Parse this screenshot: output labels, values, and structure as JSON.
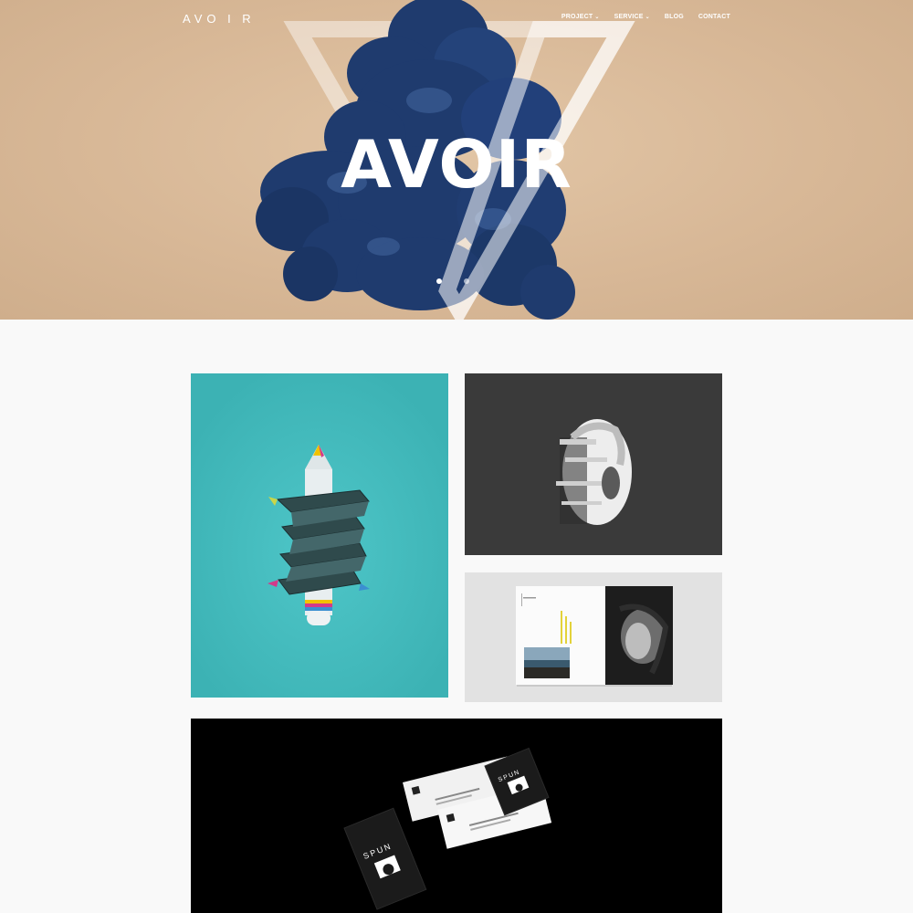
{
  "header": {
    "logo": "AVO I R",
    "nav": [
      {
        "label": "PROJECT",
        "has_dropdown": true
      },
      {
        "label": "SERVICE",
        "has_dropdown": true
      },
      {
        "label": "BLOG",
        "has_dropdown": false
      },
      {
        "label": "CONTACT",
        "has_dropdown": false
      }
    ]
  },
  "hero": {
    "title": "AVOIR",
    "slider_count": 2,
    "active_slide": 1
  },
  "portfolio": {
    "items": [
      {
        "name": "pencil-artwork"
      },
      {
        "name": "portrait-artwork"
      },
      {
        "name": "magazine-mockup"
      },
      {
        "name": "business-card-mockup",
        "brand_text": "SPUN"
      }
    ]
  },
  "colors": {
    "hero_bg": "#d8b897",
    "teal": "#41b7b9",
    "dark_tile": "#3a3a3a",
    "light_tile": "#e2e2e2",
    "ink_blue": "#1e3a6e"
  }
}
